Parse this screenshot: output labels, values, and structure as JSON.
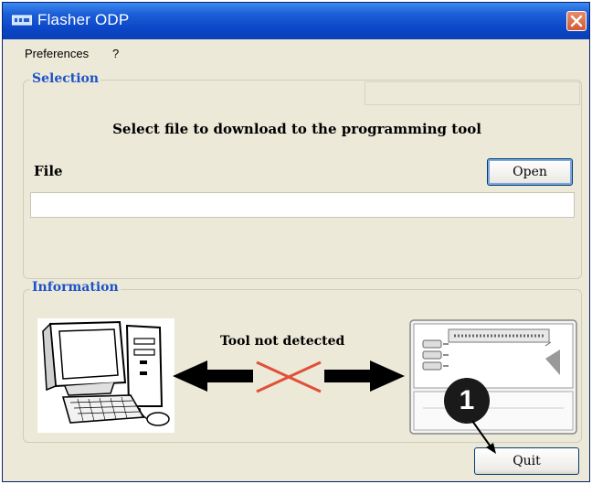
{
  "window": {
    "title": "Flasher ODP",
    "close_icon": "close-icon"
  },
  "menu": {
    "items": [
      {
        "label": "Preferences"
      },
      {
        "label": "?"
      }
    ]
  },
  "selection": {
    "legend": "Selection",
    "instruction": "Select file to download to the programming tool",
    "file_label": "File",
    "open_button": "Open",
    "file_path": ""
  },
  "information": {
    "legend": "Information",
    "status_text": "Tool not detected",
    "computer_icon": "computer-icon",
    "device_icon": "programming-tool-icon",
    "connection_state": "disconnected"
  },
  "footer": {
    "quit_button": "Quit"
  },
  "callout": {
    "number": "1"
  },
  "colors": {
    "title_bar": "#0b47c8",
    "legend_text": "#1c53c8",
    "cross": "#e0503a"
  }
}
